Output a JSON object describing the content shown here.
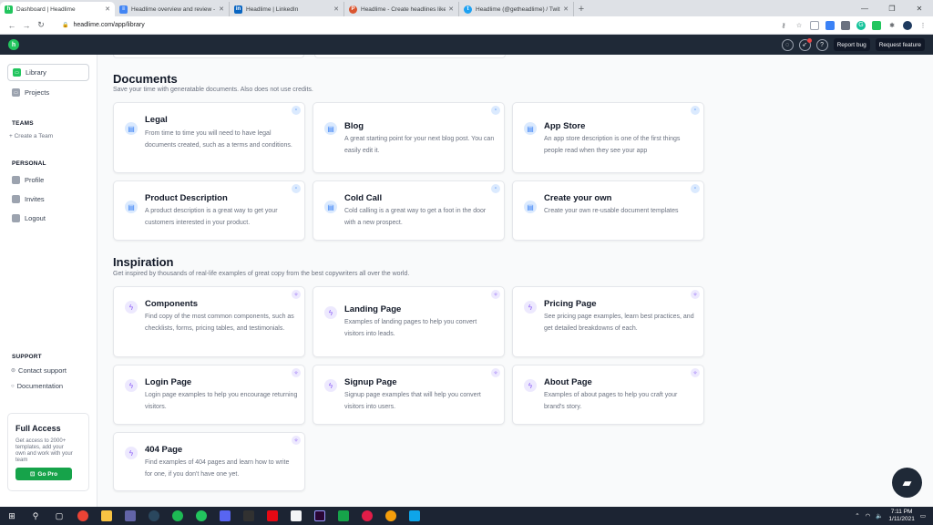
{
  "browser": {
    "tabs": [
      {
        "title": "Dashboard | Headlime",
        "favicon_color": "#22c55e",
        "active": true
      },
      {
        "title": "Headlime overview and review -",
        "favicon_color": "#4285f4",
        "active": false
      },
      {
        "title": "Headlime | LinkedIn",
        "favicon_color": "#0a66c2",
        "active": false
      },
      {
        "title": "Headlime - Create headlines like",
        "favicon_color": "#da552f",
        "active": false
      },
      {
        "title": "Headlime (@getheadlime) / Twit",
        "favicon_color": "#1da1f2",
        "active": false
      }
    ],
    "url": "headlime.com/app/library"
  },
  "header": {
    "report_bug": "Report bug",
    "request_feature": "Request feature"
  },
  "sidebar": {
    "nav": [
      {
        "label": "Library",
        "active": true
      },
      {
        "label": "Projects",
        "active": false
      }
    ],
    "teams_heading": "TEAMS",
    "create_team": "+ Create a Team",
    "personal_heading": "PERSONAL",
    "personal_items": [
      "Profile",
      "Invites",
      "Logout"
    ],
    "support_heading": "SUPPORT",
    "support_links": [
      "Contact support",
      "Documentation"
    ],
    "promo": {
      "title": "Full Access",
      "text": "Get access to 2000+ templates, add your own and work with your team",
      "button": "Go Pro"
    }
  },
  "documents": {
    "title": "Documents",
    "subtitle": "Save your time with generatable documents. Also does not use credits.",
    "cards": [
      {
        "title": "Legal",
        "desc": "From time to time you will need to have legal documents created, such as a terms and conditions."
      },
      {
        "title": "Blog",
        "desc": "A great starting point for your next blog post. You can easily edit it."
      },
      {
        "title": "App Store",
        "desc": "An app store description is one of the first things people read when they see your app"
      },
      {
        "title": "Product Description",
        "desc": "A product description is a great way to get your customers interested in your product."
      },
      {
        "title": "Cold Call",
        "desc": "Cold calling is a great way to get a foot in the door with a new prospect."
      },
      {
        "title": "Create your own",
        "desc": "Create your own re-usable document templates"
      }
    ]
  },
  "inspiration": {
    "title": "Inspiration",
    "subtitle": "Get inspired by thousands of real-life examples of great copy from the best copywriters all over the world.",
    "cards": [
      {
        "title": "Components",
        "desc": "Find copy of the most common components, such as checklists, forms, pricing tables, and testimonials."
      },
      {
        "title": "Landing Page",
        "desc": "Examples of landing pages to help you convert visitors into leads."
      },
      {
        "title": "Pricing Page",
        "desc": "See pricing page examples, learn best practices, and get detailed breakdowns of each."
      },
      {
        "title": "Login Page",
        "desc": "Login page examples to help you encourage returning visitors."
      },
      {
        "title": "Signup Page",
        "desc": "Signup page examples that will help you convert visitors into users."
      },
      {
        "title": "About Page",
        "desc": "Examples of about pages to help you craft your brand's story."
      },
      {
        "title": "404 Page",
        "desc": "Find examples of 404 pages and learn how to write for one, if you don't have one yet."
      }
    ]
  },
  "taskbar": {
    "time": "7:11 PM",
    "date": "1/11/2021"
  }
}
